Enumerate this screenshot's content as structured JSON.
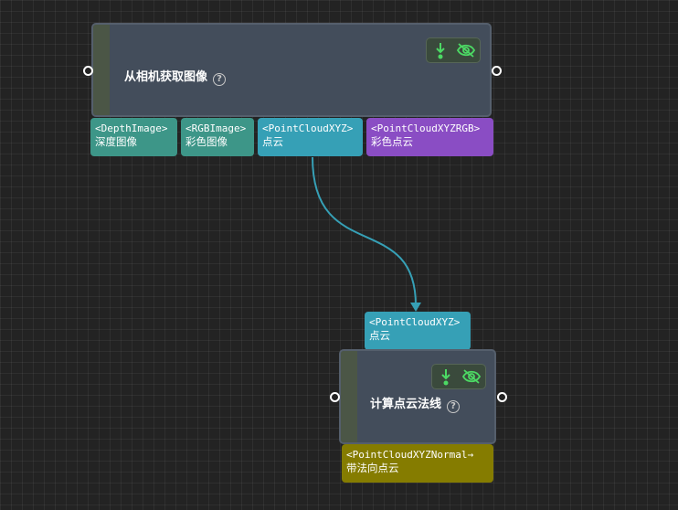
{
  "colors": {
    "depth": "#3d9688",
    "rgb": "#3d9688",
    "pointcloud": "#36a0b6",
    "pointcloud_rgb": "#8a4dc4",
    "normal": "#857c00",
    "edge": "#36a0b6",
    "run_icon": "#4cd964",
    "eye_icon": "#4cd964"
  },
  "nodes": [
    {
      "title": "从相机获取图像",
      "help": "?",
      "controls": {
        "run_icon": "download-arrow-icon",
        "visibility_icon": "eye-off-icon"
      },
      "outputs": [
        {
          "type": "<DepthImage>",
          "label": "深度图像"
        },
        {
          "type": "<RGBImage>",
          "label": "彩色图像"
        },
        {
          "type": "<PointCloudXYZ>",
          "label": "点云"
        },
        {
          "type": "<PointCloudXYZRGB>",
          "label": "彩色点云"
        }
      ]
    },
    {
      "title": "计算点云法线",
      "help": "?",
      "controls": {
        "run_icon": "download-arrow-icon",
        "visibility_icon": "eye-off-icon"
      },
      "inputs": [
        {
          "type": "<PointCloudXYZ>",
          "label": "点云"
        }
      ],
      "outputs": [
        {
          "type": "<PointCloudXYZNormal→",
          "label": "带法向点云"
        }
      ]
    }
  ]
}
